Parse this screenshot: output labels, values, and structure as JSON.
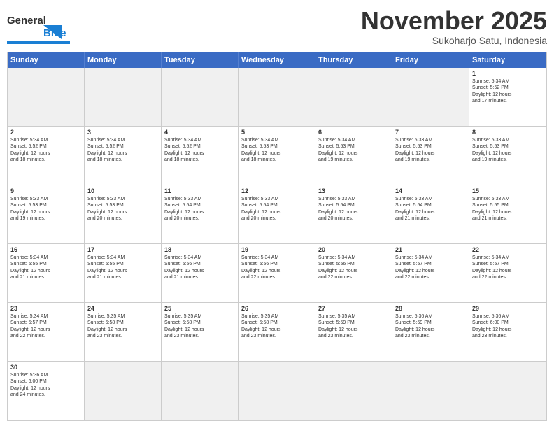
{
  "header": {
    "logo_general": "General",
    "logo_blue": "Blue",
    "month_title": "November 2025",
    "subtitle": "Sukoharjo Satu, Indonesia"
  },
  "day_headers": [
    "Sunday",
    "Monday",
    "Tuesday",
    "Wednesday",
    "Thursday",
    "Friday",
    "Saturday"
  ],
  "weeks": [
    [
      {
        "date": "",
        "info": ""
      },
      {
        "date": "",
        "info": ""
      },
      {
        "date": "",
        "info": ""
      },
      {
        "date": "",
        "info": ""
      },
      {
        "date": "",
        "info": ""
      },
      {
        "date": "",
        "info": ""
      },
      {
        "date": "1",
        "info": "Sunrise: 5:34 AM\nSunset: 5:52 PM\nDaylight: 12 hours\nand 17 minutes."
      }
    ],
    [
      {
        "date": "2",
        "info": "Sunrise: 5:34 AM\nSunset: 5:52 PM\nDaylight: 12 hours\nand 18 minutes."
      },
      {
        "date": "3",
        "info": "Sunrise: 5:34 AM\nSunset: 5:52 PM\nDaylight: 12 hours\nand 18 minutes."
      },
      {
        "date": "4",
        "info": "Sunrise: 5:34 AM\nSunset: 5:52 PM\nDaylight: 12 hours\nand 18 minutes."
      },
      {
        "date": "5",
        "info": "Sunrise: 5:34 AM\nSunset: 5:53 PM\nDaylight: 12 hours\nand 18 minutes."
      },
      {
        "date": "6",
        "info": "Sunrise: 5:34 AM\nSunset: 5:53 PM\nDaylight: 12 hours\nand 19 minutes."
      },
      {
        "date": "7",
        "info": "Sunrise: 5:33 AM\nSunset: 5:53 PM\nDaylight: 12 hours\nand 19 minutes."
      },
      {
        "date": "8",
        "info": "Sunrise: 5:33 AM\nSunset: 5:53 PM\nDaylight: 12 hours\nand 19 minutes."
      }
    ],
    [
      {
        "date": "9",
        "info": "Sunrise: 5:33 AM\nSunset: 5:53 PM\nDaylight: 12 hours\nand 19 minutes."
      },
      {
        "date": "10",
        "info": "Sunrise: 5:33 AM\nSunset: 5:53 PM\nDaylight: 12 hours\nand 20 minutes."
      },
      {
        "date": "11",
        "info": "Sunrise: 5:33 AM\nSunset: 5:54 PM\nDaylight: 12 hours\nand 20 minutes."
      },
      {
        "date": "12",
        "info": "Sunrise: 5:33 AM\nSunset: 5:54 PM\nDaylight: 12 hours\nand 20 minutes."
      },
      {
        "date": "13",
        "info": "Sunrise: 5:33 AM\nSunset: 5:54 PM\nDaylight: 12 hours\nand 20 minutes."
      },
      {
        "date": "14",
        "info": "Sunrise: 5:33 AM\nSunset: 5:54 PM\nDaylight: 12 hours\nand 21 minutes."
      },
      {
        "date": "15",
        "info": "Sunrise: 5:33 AM\nSunset: 5:55 PM\nDaylight: 12 hours\nand 21 minutes."
      }
    ],
    [
      {
        "date": "16",
        "info": "Sunrise: 5:34 AM\nSunset: 5:55 PM\nDaylight: 12 hours\nand 21 minutes."
      },
      {
        "date": "17",
        "info": "Sunrise: 5:34 AM\nSunset: 5:55 PM\nDaylight: 12 hours\nand 21 minutes."
      },
      {
        "date": "18",
        "info": "Sunrise: 5:34 AM\nSunset: 5:56 PM\nDaylight: 12 hours\nand 21 minutes."
      },
      {
        "date": "19",
        "info": "Sunrise: 5:34 AM\nSunset: 5:56 PM\nDaylight: 12 hours\nand 22 minutes."
      },
      {
        "date": "20",
        "info": "Sunrise: 5:34 AM\nSunset: 5:56 PM\nDaylight: 12 hours\nand 22 minutes."
      },
      {
        "date": "21",
        "info": "Sunrise: 5:34 AM\nSunset: 5:57 PM\nDaylight: 12 hours\nand 22 minutes."
      },
      {
        "date": "22",
        "info": "Sunrise: 5:34 AM\nSunset: 5:57 PM\nDaylight: 12 hours\nand 22 minutes."
      }
    ],
    [
      {
        "date": "23",
        "info": "Sunrise: 5:34 AM\nSunset: 5:57 PM\nDaylight: 12 hours\nand 22 minutes."
      },
      {
        "date": "24",
        "info": "Sunrise: 5:35 AM\nSunset: 5:58 PM\nDaylight: 12 hours\nand 23 minutes."
      },
      {
        "date": "25",
        "info": "Sunrise: 5:35 AM\nSunset: 5:58 PM\nDaylight: 12 hours\nand 23 minutes."
      },
      {
        "date": "26",
        "info": "Sunrise: 5:35 AM\nSunset: 5:58 PM\nDaylight: 12 hours\nand 23 minutes."
      },
      {
        "date": "27",
        "info": "Sunrise: 5:35 AM\nSunset: 5:59 PM\nDaylight: 12 hours\nand 23 minutes."
      },
      {
        "date": "28",
        "info": "Sunrise: 5:36 AM\nSunset: 5:59 PM\nDaylight: 12 hours\nand 23 minutes."
      },
      {
        "date": "29",
        "info": "Sunrise: 5:36 AM\nSunset: 6:00 PM\nDaylight: 12 hours\nand 23 minutes."
      }
    ],
    [
      {
        "date": "30",
        "info": "Sunrise: 5:36 AM\nSunset: 6:00 PM\nDaylight: 12 hours\nand 24 minutes."
      },
      {
        "date": "",
        "info": ""
      },
      {
        "date": "",
        "info": ""
      },
      {
        "date": "",
        "info": ""
      },
      {
        "date": "",
        "info": ""
      },
      {
        "date": "",
        "info": ""
      },
      {
        "date": "",
        "info": ""
      }
    ]
  ]
}
